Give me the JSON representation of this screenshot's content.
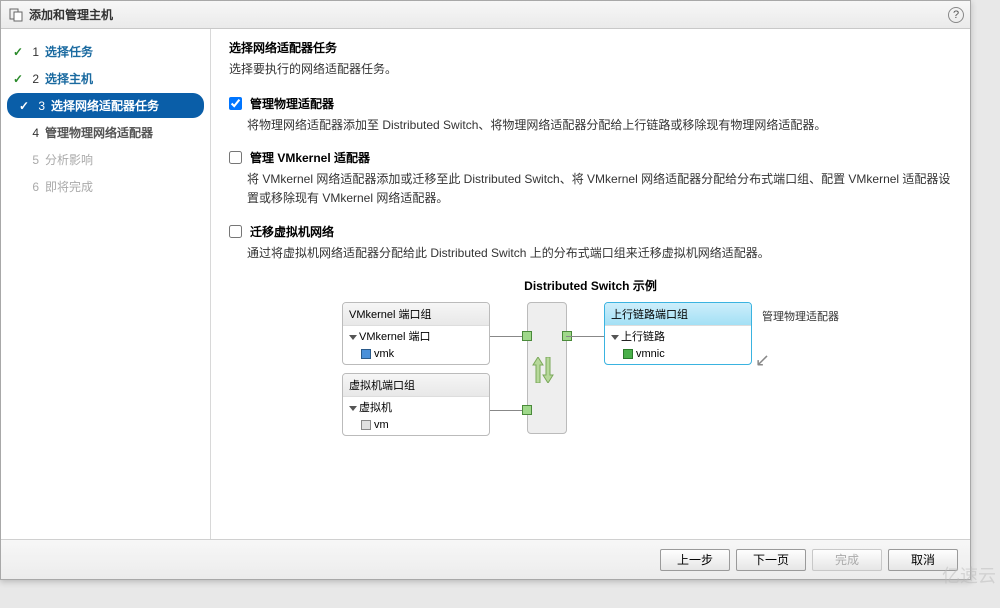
{
  "dialog": {
    "title": "添加和管理主机"
  },
  "sidebar": {
    "steps": [
      {
        "num": "1",
        "label": "选择任务",
        "state": "done"
      },
      {
        "num": "2",
        "label": "选择主机",
        "state": "done"
      },
      {
        "num": "3",
        "label": "选择网络适配器任务",
        "state": "active"
      },
      {
        "num": "4",
        "label": "管理物理网络适配器",
        "state": "pending"
      },
      {
        "num": "5",
        "label": "分析影响",
        "state": "disabled"
      },
      {
        "num": "6",
        "label": "即将完成",
        "state": "disabled"
      }
    ]
  },
  "main": {
    "heading": "选择网络适配器任务",
    "subtitle": "选择要执行的网络适配器任务。",
    "options": [
      {
        "checked": true,
        "label": "管理物理适配器",
        "desc": "将物理网络适配器添加至 Distributed Switch、将物理网络适配器分配给上行链路或移除现有物理网络适配器。"
      },
      {
        "checked": false,
        "label": "管理 VMkernel 适配器",
        "desc": "将 VMkernel 网络适配器添加或迁移至此 Distributed Switch、将 VMkernel 网络适配器分配给分布式端口组、配置 VMkernel 适配器设置或移除现有 VMkernel 网络适配器。"
      },
      {
        "checked": false,
        "label": "迁移虚拟机网络",
        "desc": "通过将虚拟机网络适配器分配给此 Distributed Switch 上的分布式端口组来迁移虚拟机网络适配器。"
      }
    ],
    "diagram": {
      "title": "Distributed Switch 示例",
      "left_groups": [
        {
          "header": "VMkernel 端口组",
          "item": "VMkernel 端口",
          "sub": "vmk"
        },
        {
          "header": "虚拟机端口组",
          "item": "虚拟机",
          "sub": "vm"
        }
      ],
      "right_group": {
        "header": "上行链路端口组",
        "item": "上行链路",
        "sub": "vmnic"
      },
      "side_label": "管理物理适配器"
    }
  },
  "footer": {
    "back": "上一步",
    "next": "下一页",
    "finish": "完成",
    "cancel": "取消"
  }
}
